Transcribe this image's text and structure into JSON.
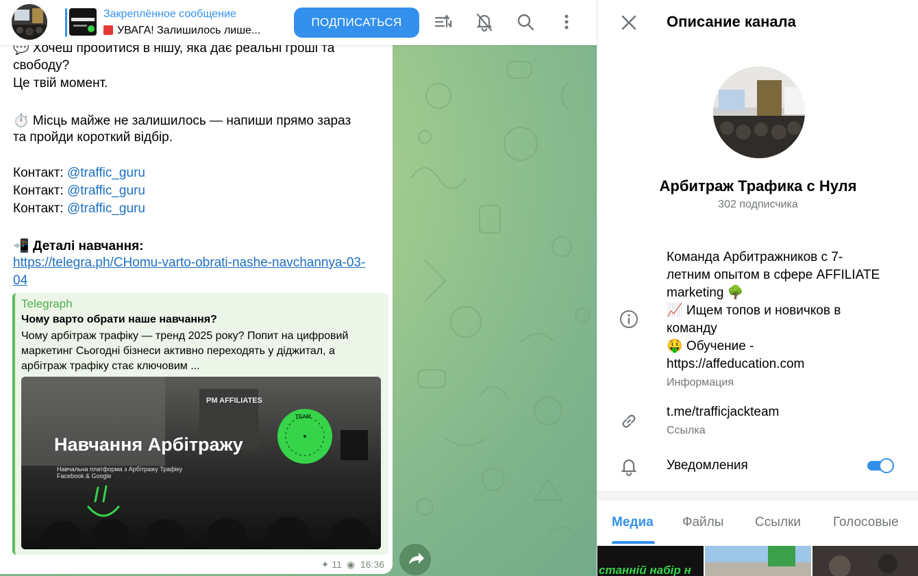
{
  "chat": {
    "header": {
      "pinned_title": "Закреплённое сообщение",
      "pinned_text": "УВАГА! Залишилось лише...",
      "subscribe_label": "ПОДПИСАТЬСЯ"
    },
    "message": {
      "lines": [
        "💬 Хочеш пробитися в нішу, яка дає реальні гроші та",
        "свободу?",
        "Це твій момент.",
        "⏱️ Місць майже не залишилось — напиши прямо зараз",
        "та пройди короткий відбір."
      ],
      "contacts": [
        {
          "label": "Контакт: ",
          "handle": "@traffic_guru"
        },
        {
          "label": "Контакт: ",
          "handle": "@traffic_guru"
        },
        {
          "label": "Контакт: ",
          "handle": "@traffic_guru"
        }
      ],
      "details_heading": "📲 Деталі навчання:",
      "url_line1": "https://telegra.ph/CHomu-varto-obrati-nashe-navchannya-03-",
      "url_line2": "04",
      "preview": {
        "site": "Telegraph",
        "title": "Чому варто обрати наше навчання?",
        "description": "Чому арбітраж трафіку — тренд 2025 року? Попит на цифровий маркетинг Сьогодні бізнеси активно переходять у діджитал, а арбітраж трафіку стає ключовим ...",
        "image_heading": "Навчання Арбітражу",
        "image_sub1": "Навчальна платформа з Арбітражу Трафіку",
        "image_sub2": "Facebook & Google",
        "image_badge": "TEAM",
        "image_banner": "PM AFFILIATES"
      },
      "pin_count": "11",
      "time": "16:36"
    }
  },
  "panel": {
    "heading": "Описание канала",
    "channel_name": "Арбитраж Трафика с Нуля",
    "subscribers": "302 подписчика",
    "description_lines": [
      "Команда Арбитражников с 7-",
      "летним опытом в сфере AFFILIATE",
      "marketing 🌳",
      "📈 Ищем топов и новичков в",
      "команду",
      "🤑 Обучение -",
      "https://affeducation.com"
    ],
    "info_label": "Информация",
    "link_value": "t.me/trafficjackteam",
    "link_label": "Ссылка",
    "notifications_label": "Уведомления",
    "notifications_on": true,
    "tabs": [
      {
        "label": "Медиа",
        "active": true
      },
      {
        "label": "Файлы",
        "active": false
      },
      {
        "label": "Ссылки",
        "active": false
      },
      {
        "label": "Голосовые",
        "active": false
      }
    ],
    "thumb_text": "станній набір н"
  },
  "colors": {
    "accent": "#3390ec",
    "link": "#1b6fc1",
    "preview_green": "#4fae4e",
    "muted": "#707579",
    "badge_green": "#37d44a"
  }
}
